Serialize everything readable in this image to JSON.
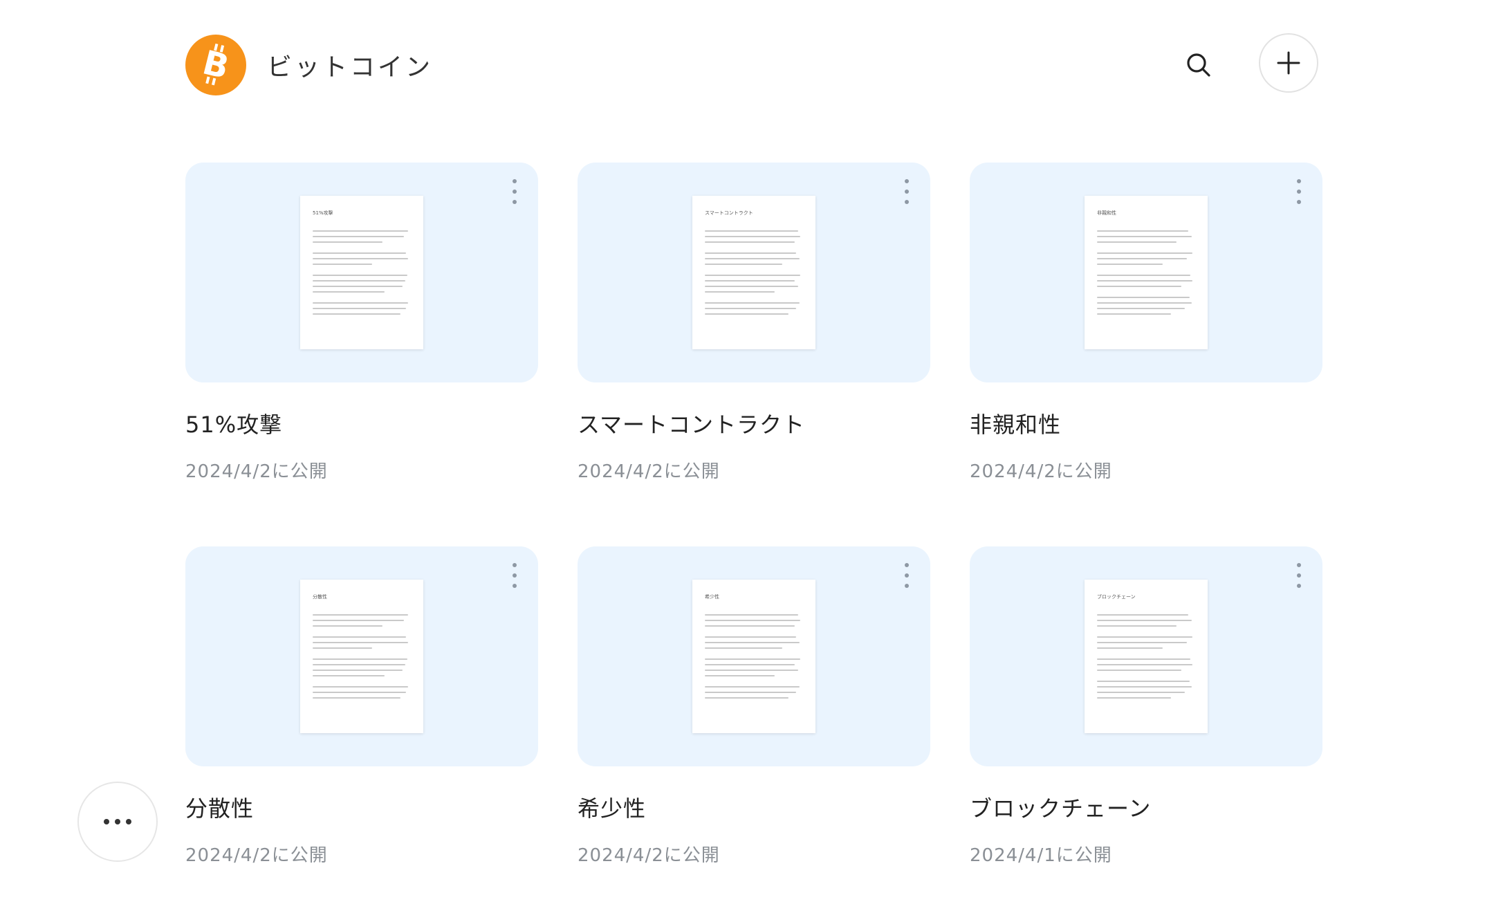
{
  "header": {
    "title": "ビットコイン",
    "logo_icon": "bitcoin-icon",
    "search_icon": "search-icon",
    "add_icon": "plus-icon",
    "accent_color": "#f7931a"
  },
  "cards": [
    {
      "title": "51%攻撃",
      "date": "2024/4/2に公開",
      "doc_title": "51%攻撃"
    },
    {
      "title": "スマートコントラクト",
      "date": "2024/4/2に公開",
      "doc_title": "スマートコントラクト"
    },
    {
      "title": "非親和性",
      "date": "2024/4/2に公開",
      "doc_title": "非親和性"
    },
    {
      "title": "分散性",
      "date": "2024/4/2に公開",
      "doc_title": "分散性"
    },
    {
      "title": "希少性",
      "date": "2024/4/2に公開",
      "doc_title": "希少性"
    },
    {
      "title": "ブロックチェーン",
      "date": "2024/4/1に公開",
      "doc_title": "ブロックチェーン"
    }
  ],
  "colors": {
    "card_background": "#eaf4fe",
    "date_text": "#8a8f95"
  },
  "more_icon": "more-horizontal-icon"
}
